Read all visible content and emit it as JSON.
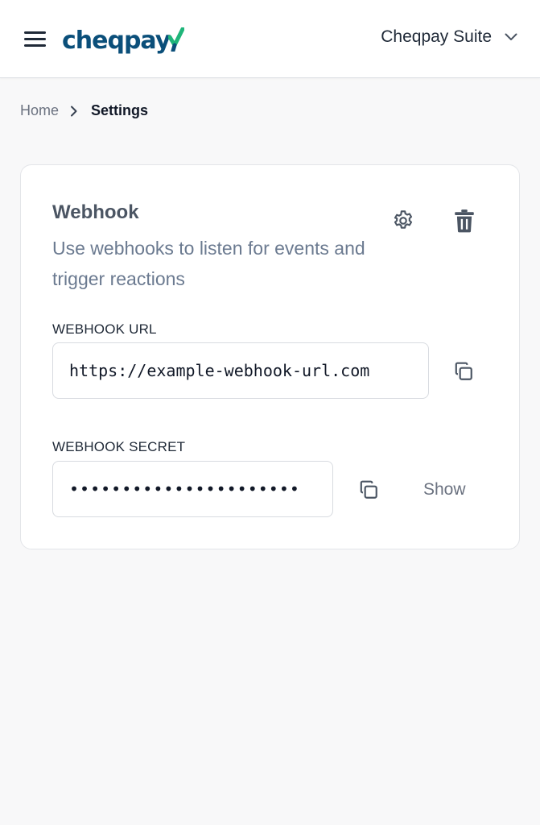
{
  "header": {
    "logo_text": "cheqpay",
    "brand_color": "#0b4f7a",
    "accent_color": "#1fb57a",
    "suite_label": "Cheqpay Suite",
    "menu_icon": "hamburger-menu-icon",
    "dropdown_icon": "chevron-down-icon"
  },
  "breadcrumb": {
    "home": "Home",
    "separator_icon": "chevron-right-icon",
    "current": "Settings"
  },
  "webhook": {
    "title": "Webhook",
    "description": "Use webhooks to listen for events and trigger reactions",
    "settings_icon": "gear-icon",
    "delete_icon": "trash-icon",
    "url_label": "WEBHOOK URL",
    "url_value": "https://example-webhook-url.com",
    "secret_label": "WEBHOOK SECRET",
    "secret_value": "••••••••••••••••••••••",
    "copy_icon": "copy-icon",
    "show_label": "Show"
  }
}
